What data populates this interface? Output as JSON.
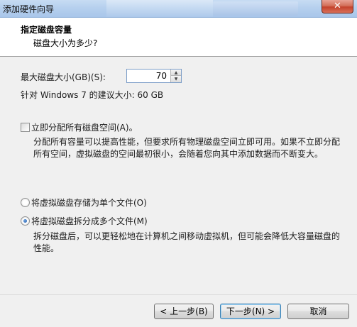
{
  "window": {
    "title": "添加硬件向导",
    "close_label": "✕"
  },
  "header": {
    "title": "指定磁盘容量",
    "subtitle": "磁盘大小为多少?"
  },
  "disk_size": {
    "label": "最大磁盘大小(GB)(S):",
    "value": "70",
    "recommendation": "针对 Windows 7 的建议大小: 60 GB"
  },
  "allocate": {
    "label": "立即分配所有磁盘空间(A)。",
    "checked": false,
    "description_line1": "分配所有容量可以提高性能，但要求所有物理磁盘空间立即可用。如果不立即分配",
    "description_line2": "所有空间，虚拟磁盘的空间最初很小，会随着您向其中添加数据而不断变大。"
  },
  "storage_options": [
    {
      "label": "将虚拟磁盘存储为单个文件(O)",
      "selected": false
    },
    {
      "label": "将虚拟磁盘拆分成多个文件(M)",
      "selected": true
    }
  ],
  "split_description": {
    "line1": "拆分磁盘后，可以更轻松地在计算机之间移动虚拟机，但可能会降低大容量磁盘的",
    "line2": "性能。"
  },
  "footer": {
    "back_label": "< 上一步(B)",
    "next_label": "下一步(N) >",
    "cancel_label": "取消"
  }
}
